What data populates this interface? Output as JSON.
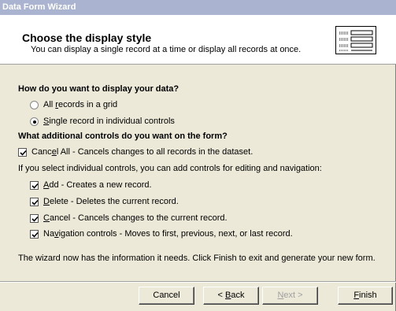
{
  "window": {
    "title": "Data Form Wizard"
  },
  "header": {
    "title": "Choose the display style",
    "subtitle": "You can display a single record at a time or display all records at once."
  },
  "display_section": {
    "heading": "How do you want to display your data?",
    "options": [
      {
        "label_pre": "All ",
        "label_u": "r",
        "label_post": "ecords in a grid",
        "checked": false
      },
      {
        "label_pre": "",
        "label_u": "S",
        "label_post": "ingle record in individual controls",
        "checked": true
      }
    ]
  },
  "controls_section": {
    "heading": "What additional controls do you want on the form?",
    "cancel_all": {
      "label_pre": "Canc",
      "label_u": "e",
      "label_post": "l All - Cancels changes to all records in the dataset.",
      "checked": true
    },
    "info": "If you select individual controls, you can add controls for editing and navigation:",
    "items": [
      {
        "label_u": "A",
        "label_post": "dd - Creates a new record.",
        "checked": true
      },
      {
        "label_u": "D",
        "label_post": "elete - Deletes the current record.",
        "checked": true
      },
      {
        "label_u": "C",
        "label_post": "ancel - Cancels changes to the current record.",
        "checked": true
      },
      {
        "label_pre": "Na",
        "label_u": "v",
        "label_post": "igation controls - Moves to first, previous, next, or last record.",
        "checked": true
      }
    ]
  },
  "footer_text": "The wizard now has the information it needs. Click Finish to exit and generate your new form.",
  "buttons": {
    "cancel": "Cancel",
    "back_pre": "< ",
    "back_u": "B",
    "back_post": "ack",
    "next_u": "N",
    "next_post": "ext >",
    "finish_u": "F",
    "finish_post": "inish"
  }
}
